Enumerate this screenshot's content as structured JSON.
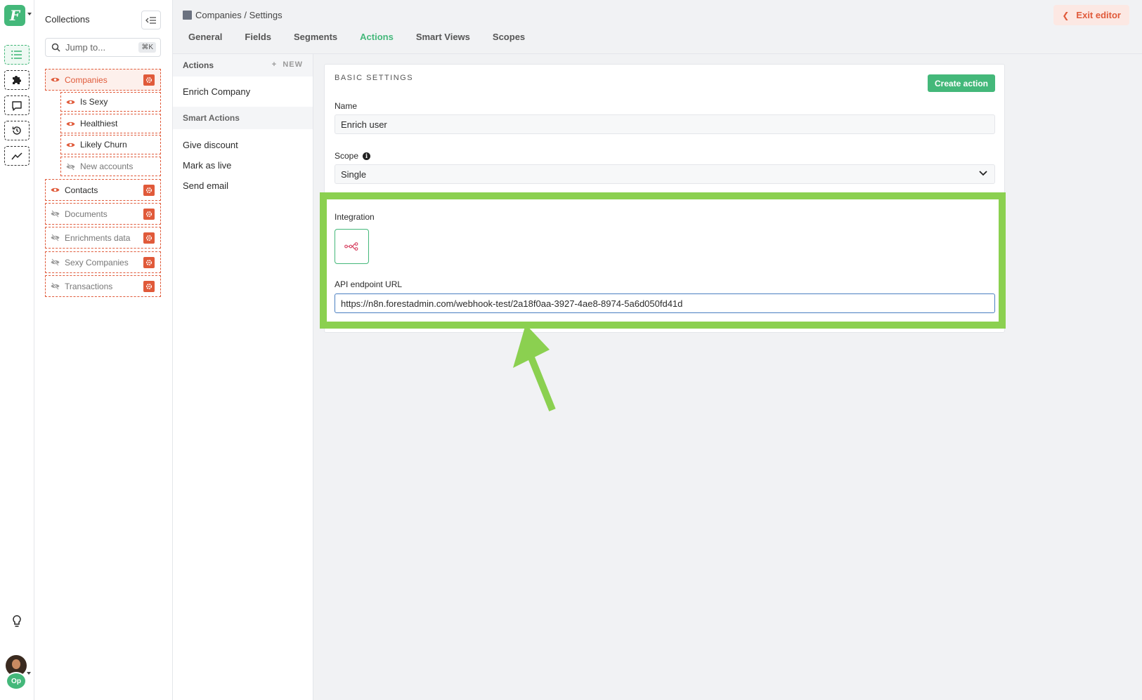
{
  "app": {
    "logo_letter": "F",
    "accent_color": "#44b87a",
    "danger_color": "#e05a3a"
  },
  "rail": {
    "items": [
      {
        "icon": "list-icon",
        "active": true
      },
      {
        "icon": "puzzle-icon",
        "active": false
      },
      {
        "icon": "chat-icon",
        "active": false
      },
      {
        "icon": "history-icon",
        "active": false
      },
      {
        "icon": "chart-icon",
        "active": false
      }
    ],
    "help_icon": "lightbulb-icon",
    "user_badge": "Op"
  },
  "collections": {
    "title": "Collections",
    "search_placeholder": "Jump to...",
    "shortcut": "⌘K",
    "items": [
      {
        "label": "Companies",
        "visible": true,
        "selected": true
      },
      {
        "label": "Is Sexy",
        "visible": true,
        "sub": true
      },
      {
        "label": "Healthiest",
        "visible": true,
        "sub": true
      },
      {
        "label": "Likely Churn",
        "visible": true,
        "sub": true
      },
      {
        "label": "New accounts",
        "visible": false,
        "sub": true
      },
      {
        "label": "Contacts",
        "visible": true
      },
      {
        "label": "Documents",
        "visible": false
      },
      {
        "label": "Enrichments data",
        "visible": false
      },
      {
        "label": "Sexy Companies",
        "visible": false
      },
      {
        "label": "Transactions",
        "visible": false
      }
    ]
  },
  "header": {
    "breadcrumb": "Companies / Settings",
    "tabs": [
      "General",
      "Fields",
      "Segments",
      "Actions",
      "Smart Views",
      "Scopes"
    ],
    "active_tab": "Actions",
    "exit_label": "Exit editor"
  },
  "actions_panel": {
    "title": "Actions",
    "new_label": "NEW",
    "actions": [
      "Enrich Company"
    ],
    "smart_title": "Smart Actions",
    "smart_actions": [
      "Give discount",
      "Mark as live",
      "Send email"
    ]
  },
  "form": {
    "heading": "BASIC SETTINGS",
    "create_label": "Create action",
    "name_label": "Name",
    "name_value": "Enrich user",
    "scope_label": "Scope",
    "scope_value": "Single",
    "integration_label": "Integration",
    "integration_icon": "webhook-icon",
    "url_label": "API endpoint URL",
    "url_value": "https://n8n.forestadmin.com/webhook-test/2a18f0aa-3927-4ae8-8974-5a6d050fd41d"
  },
  "annotation": {
    "highlight_color": "#8bd050"
  }
}
